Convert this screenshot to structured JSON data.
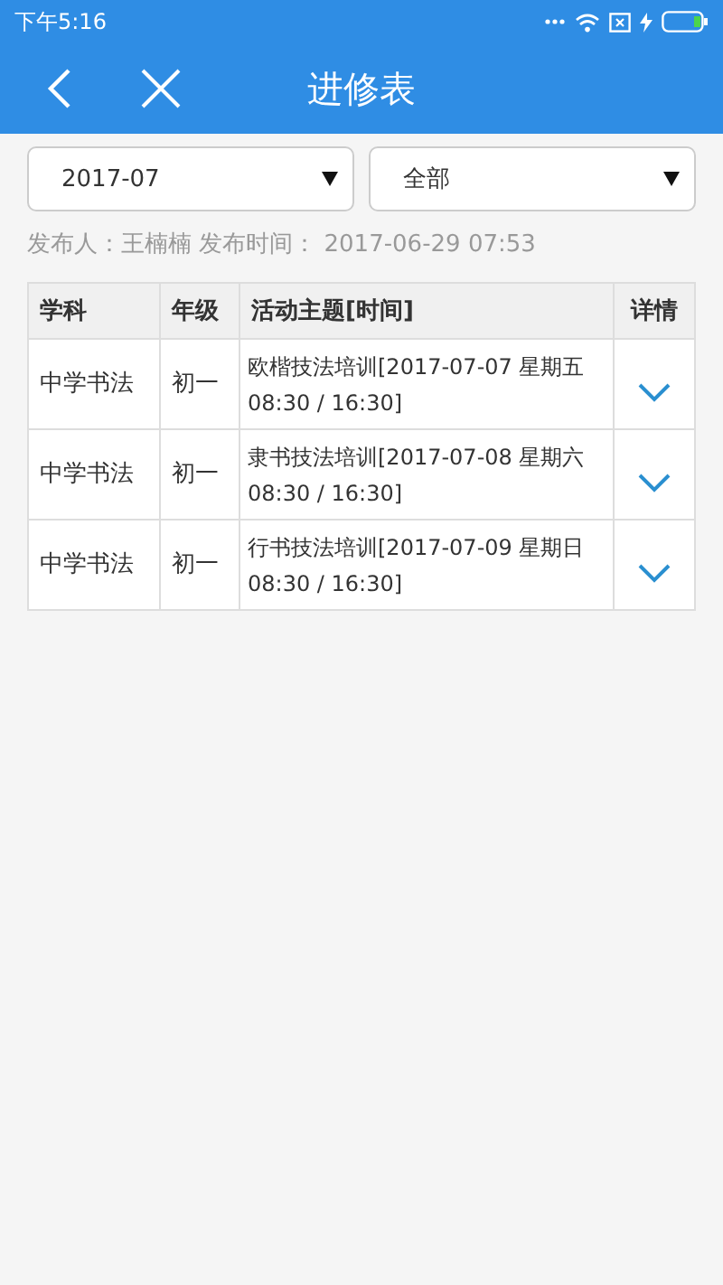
{
  "status_bar": {
    "time": "下午5:16"
  },
  "header": {
    "title": "进修表"
  },
  "filters": [
    {
      "value": "2017-07"
    },
    {
      "value": "全部"
    }
  ],
  "publish_info": "发布人：王楠楠 发布时间： 2017-06-29 07:53",
  "table": {
    "columns": [
      "学科",
      "年级",
      "活动主题[时间]",
      "详情"
    ],
    "rows": [
      {
        "subject": "中学书法",
        "grade": "初一",
        "topic": "欧楷技法培训[2017-07-07 星期五\n08:30 / 16:30]",
        "expanded": false
      },
      {
        "subject": "中学书法",
        "grade": "初一",
        "topic": "隶书技法培训[2017-07-08 星期六\n08:30 / 16:30]",
        "expanded": false
      },
      {
        "subject": "中学书法",
        "grade": "初一",
        "topic": "行书技法培训[2017-07-09 星期日\n08:30 / 16:30]",
        "expanded": false
      }
    ]
  }
}
